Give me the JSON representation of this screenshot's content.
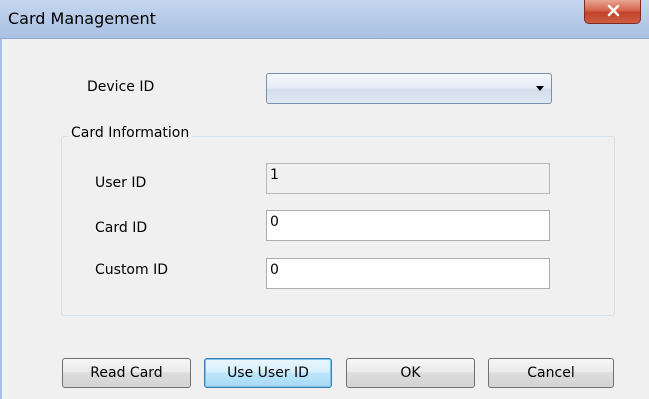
{
  "window": {
    "title": "Card Management"
  },
  "device": {
    "label": "Device ID",
    "selected_value": ""
  },
  "card_information": {
    "group_title": "Card Information",
    "user_id": {
      "label": "User ID",
      "value": "1"
    },
    "card_id": {
      "label": "Card ID",
      "value": "0"
    },
    "custom_id": {
      "label": "Custom ID",
      "value": "0"
    }
  },
  "buttons": {
    "read_card": "Read Card",
    "use_user_id": "Use User ID",
    "ok": "OK",
    "cancel": "Cancel"
  },
  "icons": {
    "close": "close-icon",
    "dropdown": "chevron-down-icon"
  },
  "colors": {
    "titlebar": "#b9cde9",
    "close_button": "#c0432a",
    "dialog_background": "#f0f0f0",
    "default_button_border": "#3c7fb1"
  }
}
